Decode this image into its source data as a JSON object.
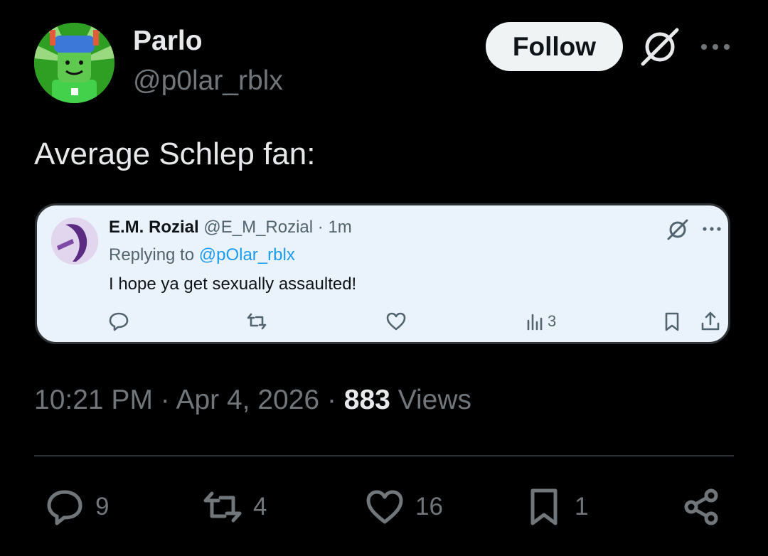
{
  "tweet": {
    "author": {
      "display_name": "Parlo",
      "handle": "@p0lar_rblx",
      "avatar": "roblox-avatar"
    },
    "follow_label": "Follow",
    "text": "Average Schlep fan:",
    "time": "10:21 PM",
    "date": "Apr 4, 2026",
    "views_count": "883",
    "views_label": "Views",
    "counts": {
      "replies": "9",
      "reposts": "4",
      "likes": "16",
      "bookmarks": "1"
    }
  },
  "quoted_screenshot": {
    "name": "E.M. Rozial",
    "handle": "@E_M_Rozial",
    "time": "1m",
    "replying_to_label": "Replying to",
    "replying_to_handle": "@pOlar_rblx",
    "text": "I hope ya get sexually assaulted!",
    "views": "3"
  },
  "icons": {
    "grok": "grok-icon",
    "more": "more-icon",
    "reply": "reply-icon",
    "repost": "repost-icon",
    "like": "heart-icon",
    "bookmark": "bookmark-icon",
    "share": "share-icon",
    "views": "views-icon"
  },
  "colors": {
    "background": "#000000",
    "text": "#e7e9ea",
    "muted": "#71767b",
    "link": "#1d9bf0",
    "card_bg": "#eaf2fb"
  }
}
